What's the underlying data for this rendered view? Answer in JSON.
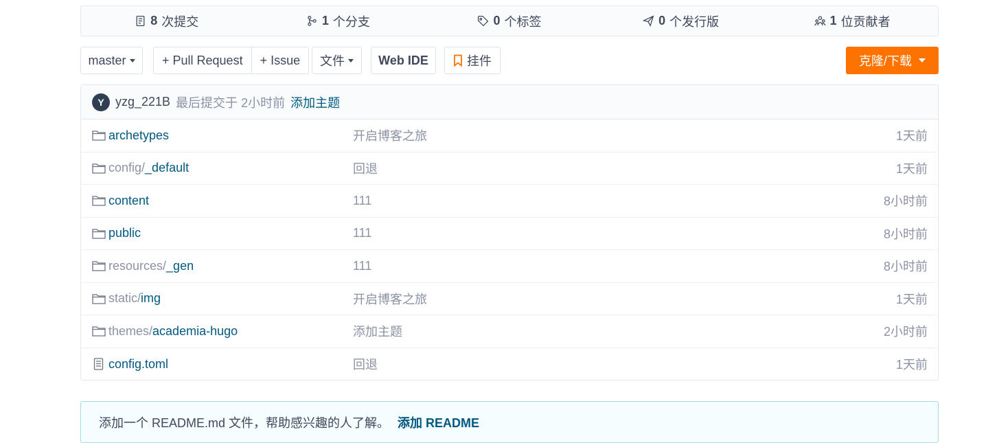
{
  "stats": [
    {
      "count": "8",
      "label": "次提交",
      "icon": "commit-icon"
    },
    {
      "count": "1",
      "label": "个分支",
      "icon": "branch-icon"
    },
    {
      "count": "0",
      "label": "个标签",
      "icon": "tag-icon"
    },
    {
      "count": "0",
      "label": "个发行版",
      "icon": "release-icon"
    },
    {
      "count": "1",
      "label": "位贡献者",
      "icon": "contributors-icon"
    }
  ],
  "toolbar": {
    "branch": "master",
    "pull_request": "+ Pull Request",
    "issue": "+ Issue",
    "file": "文件",
    "web_ide": "Web IDE",
    "widget": "挂件",
    "clone": "克隆/下载"
  },
  "last_commit": {
    "avatar_letter": "Y",
    "author": "yzg_221B",
    "text": "最后提交于",
    "time": "2小时前",
    "message": "添加主题"
  },
  "files": [
    {
      "prefix": "",
      "name": "archetypes",
      "type": "folder",
      "message": "开启博客之旅",
      "time": "1天前"
    },
    {
      "prefix": "config/",
      "name": "_default",
      "type": "folder",
      "message": "回退",
      "time": "1天前"
    },
    {
      "prefix": "",
      "name": "content",
      "type": "folder",
      "message": "111",
      "time": "8小时前"
    },
    {
      "prefix": "",
      "name": "public",
      "type": "folder",
      "message": "111",
      "time": "8小时前"
    },
    {
      "prefix": "resources/",
      "name": "_gen",
      "type": "folder",
      "message": "111",
      "time": "8小时前"
    },
    {
      "prefix": "static/",
      "name": "img",
      "type": "folder",
      "message": "开启博客之旅",
      "time": "1天前"
    },
    {
      "prefix": "themes/",
      "name": "academia-hugo",
      "type": "folder",
      "message": "添加主题",
      "time": "2小时前"
    },
    {
      "prefix": "",
      "name": "config.toml",
      "type": "file",
      "message": "回退",
      "time": "1天前"
    }
  ],
  "readme": {
    "text": "添加一个 README.md 文件，帮助感兴趣的人了解。",
    "link": "添加 README"
  },
  "colors": {
    "accent": "#fe7300",
    "link": "#005980",
    "muted": "#8c92a4"
  }
}
